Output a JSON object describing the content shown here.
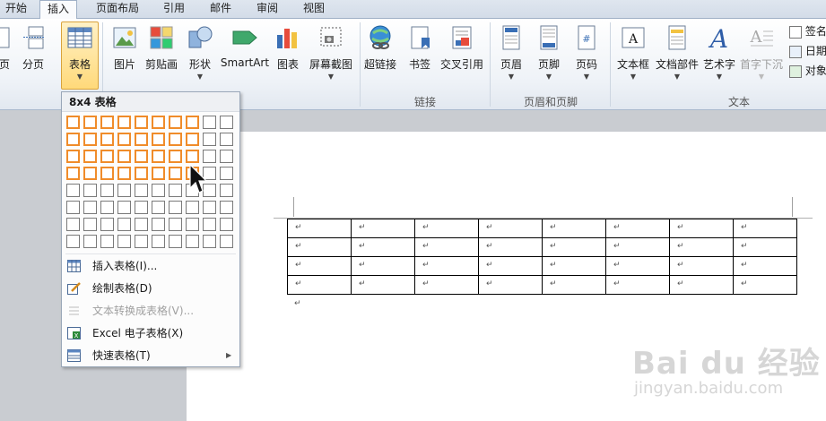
{
  "tabs": [
    {
      "label": "开始"
    },
    {
      "label": "插入",
      "active": true
    },
    {
      "label": "页面布局"
    },
    {
      "label": "引用"
    },
    {
      "label": "邮件"
    },
    {
      "label": "审阅"
    },
    {
      "label": "视图"
    }
  ],
  "ribbon": {
    "buttons": [
      {
        "label": "页",
        "icon": "page-icon"
      },
      {
        "label": "分页",
        "icon": "page-break-icon"
      },
      {
        "label": "表格",
        "icon": "table-icon",
        "selected": true,
        "dropdown": true
      },
      {
        "label": "图片",
        "icon": "picture-icon"
      },
      {
        "label": "剪贴画",
        "icon": "clipart-icon"
      },
      {
        "label": "形状",
        "icon": "shapes-icon",
        "dropdown": true
      },
      {
        "label": "SmartArt",
        "icon": "smartart-icon"
      },
      {
        "label": "图表",
        "icon": "chart-icon"
      },
      {
        "label": "屏幕截图",
        "icon": "screenshot-icon",
        "dropdown": true
      },
      {
        "label": "超链接",
        "icon": "hyperlink-icon"
      },
      {
        "label": "书签",
        "icon": "bookmark-icon"
      },
      {
        "label": "交叉引用",
        "icon": "cross-reference-icon"
      },
      {
        "label": "页眉",
        "icon": "header-icon",
        "dropdown": true
      },
      {
        "label": "页脚",
        "icon": "footer-icon",
        "dropdown": true
      },
      {
        "label": "页码",
        "icon": "page-number-icon",
        "dropdown": true
      },
      {
        "label": "文本框",
        "icon": "textbox-icon",
        "dropdown": true
      },
      {
        "label": "文档部件",
        "icon": "quick-parts-icon",
        "dropdown": true
      },
      {
        "label": "艺术字",
        "icon": "wordart-icon",
        "dropdown": true
      },
      {
        "label": "首字下沉",
        "icon": "dropcap-icon",
        "dropdown": true,
        "disabled": true
      }
    ],
    "side_items": [
      {
        "label": "签名",
        "icon": "signature-icon"
      },
      {
        "label": "日期",
        "icon": "date-icon"
      },
      {
        "label": "对象",
        "icon": "object-icon"
      }
    ],
    "groups": [
      {
        "label": "链接"
      },
      {
        "label": "页眉和页脚"
      },
      {
        "label": "文本"
      }
    ]
  },
  "menu": {
    "title": "8x4 表格",
    "grid": {
      "cols": 10,
      "rows": 8,
      "selected_cols": 8,
      "selected_rows": 4
    },
    "items": [
      {
        "label": "插入表格(I)...",
        "icon": "insert-table-icon",
        "disabled": false
      },
      {
        "label": "绘制表格(D)",
        "icon": "draw-table-icon",
        "disabled": false
      },
      {
        "label": "文本转换成表格(V)...",
        "icon": "text-to-table-icon",
        "disabled": true
      },
      {
        "label": "Excel 电子表格(X)",
        "icon": "excel-icon",
        "disabled": false
      },
      {
        "label": "快速表格(T)",
        "icon": "quick-table-icon",
        "disabled": false,
        "submenu": true
      }
    ]
  },
  "document": {
    "table": {
      "rows": 4,
      "cols": 8,
      "cell_mark": "↵"
    },
    "trailing_mark": "↵"
  },
  "watermark": {
    "line1": "Bai du 经验",
    "line2": "jingyan.baidu.com"
  }
}
